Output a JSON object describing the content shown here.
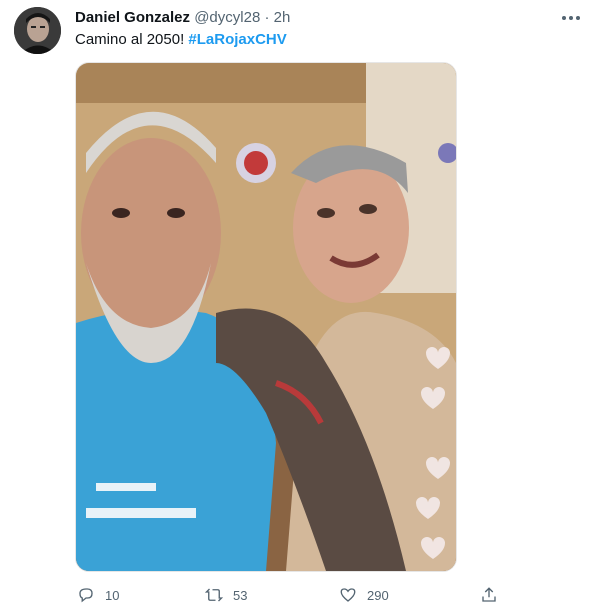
{
  "tweet": {
    "author_name": "Daniel Gonzalez",
    "handle": "@dycyl28",
    "separator": "·",
    "time": "2h",
    "text": "Camino al 2050!",
    "hashtag": "#LaRojaxCHV",
    "media_image": "selfie-two-older-men-in-locker-room"
  },
  "actions": {
    "reply_count": "10",
    "retweet_count": "53",
    "like_count": "290"
  },
  "icons": {
    "more": "more-horizontal-icon",
    "reply": "reply-icon",
    "retweet": "retweet-icon",
    "like": "heart-icon",
    "share": "share-icon"
  },
  "colors": {
    "hashtag": "#1d9bf0",
    "secondary_text": "#536471",
    "primary_text": "#0f1419"
  }
}
